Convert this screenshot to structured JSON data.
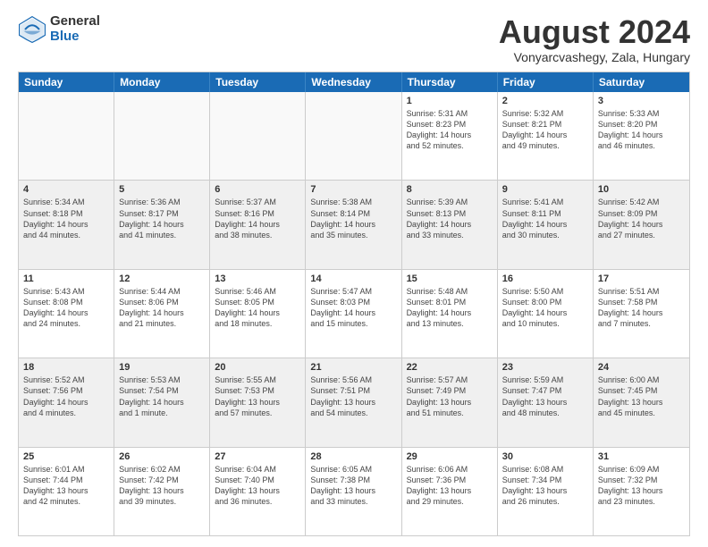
{
  "logo": {
    "general": "General",
    "blue": "Blue"
  },
  "title": "August 2024",
  "subtitle": "Vonyarcvashegy, Zala, Hungary",
  "days": [
    "Sunday",
    "Monday",
    "Tuesday",
    "Wednesday",
    "Thursday",
    "Friday",
    "Saturday"
  ],
  "weeks": [
    [
      {
        "day": "",
        "text": "",
        "empty": true
      },
      {
        "day": "",
        "text": "",
        "empty": true
      },
      {
        "day": "",
        "text": "",
        "empty": true
      },
      {
        "day": "",
        "text": "",
        "empty": true
      },
      {
        "day": "1",
        "text": "Sunrise: 5:31 AM\nSunset: 8:23 PM\nDaylight: 14 hours\nand 52 minutes.",
        "empty": false
      },
      {
        "day": "2",
        "text": "Sunrise: 5:32 AM\nSunset: 8:21 PM\nDaylight: 14 hours\nand 49 minutes.",
        "empty": false
      },
      {
        "day": "3",
        "text": "Sunrise: 5:33 AM\nSunset: 8:20 PM\nDaylight: 14 hours\nand 46 minutes.",
        "empty": false
      }
    ],
    [
      {
        "day": "4",
        "text": "Sunrise: 5:34 AM\nSunset: 8:18 PM\nDaylight: 14 hours\nand 44 minutes.",
        "empty": false,
        "shaded": true
      },
      {
        "day": "5",
        "text": "Sunrise: 5:36 AM\nSunset: 8:17 PM\nDaylight: 14 hours\nand 41 minutes.",
        "empty": false,
        "shaded": true
      },
      {
        "day": "6",
        "text": "Sunrise: 5:37 AM\nSunset: 8:16 PM\nDaylight: 14 hours\nand 38 minutes.",
        "empty": false,
        "shaded": true
      },
      {
        "day": "7",
        "text": "Sunrise: 5:38 AM\nSunset: 8:14 PM\nDaylight: 14 hours\nand 35 minutes.",
        "empty": false,
        "shaded": true
      },
      {
        "day": "8",
        "text": "Sunrise: 5:39 AM\nSunset: 8:13 PM\nDaylight: 14 hours\nand 33 minutes.",
        "empty": false,
        "shaded": true
      },
      {
        "day": "9",
        "text": "Sunrise: 5:41 AM\nSunset: 8:11 PM\nDaylight: 14 hours\nand 30 minutes.",
        "empty": false,
        "shaded": true
      },
      {
        "day": "10",
        "text": "Sunrise: 5:42 AM\nSunset: 8:09 PM\nDaylight: 14 hours\nand 27 minutes.",
        "empty": false,
        "shaded": true
      }
    ],
    [
      {
        "day": "11",
        "text": "Sunrise: 5:43 AM\nSunset: 8:08 PM\nDaylight: 14 hours\nand 24 minutes.",
        "empty": false
      },
      {
        "day": "12",
        "text": "Sunrise: 5:44 AM\nSunset: 8:06 PM\nDaylight: 14 hours\nand 21 minutes.",
        "empty": false
      },
      {
        "day": "13",
        "text": "Sunrise: 5:46 AM\nSunset: 8:05 PM\nDaylight: 14 hours\nand 18 minutes.",
        "empty": false
      },
      {
        "day": "14",
        "text": "Sunrise: 5:47 AM\nSunset: 8:03 PM\nDaylight: 14 hours\nand 15 minutes.",
        "empty": false
      },
      {
        "day": "15",
        "text": "Sunrise: 5:48 AM\nSunset: 8:01 PM\nDaylight: 14 hours\nand 13 minutes.",
        "empty": false
      },
      {
        "day": "16",
        "text": "Sunrise: 5:50 AM\nSunset: 8:00 PM\nDaylight: 14 hours\nand 10 minutes.",
        "empty": false
      },
      {
        "day": "17",
        "text": "Sunrise: 5:51 AM\nSunset: 7:58 PM\nDaylight: 14 hours\nand 7 minutes.",
        "empty": false
      }
    ],
    [
      {
        "day": "18",
        "text": "Sunrise: 5:52 AM\nSunset: 7:56 PM\nDaylight: 14 hours\nand 4 minutes.",
        "empty": false,
        "shaded": true
      },
      {
        "day": "19",
        "text": "Sunrise: 5:53 AM\nSunset: 7:54 PM\nDaylight: 14 hours\nand 1 minute.",
        "empty": false,
        "shaded": true
      },
      {
        "day": "20",
        "text": "Sunrise: 5:55 AM\nSunset: 7:53 PM\nDaylight: 13 hours\nand 57 minutes.",
        "empty": false,
        "shaded": true
      },
      {
        "day": "21",
        "text": "Sunrise: 5:56 AM\nSunset: 7:51 PM\nDaylight: 13 hours\nand 54 minutes.",
        "empty": false,
        "shaded": true
      },
      {
        "day": "22",
        "text": "Sunrise: 5:57 AM\nSunset: 7:49 PM\nDaylight: 13 hours\nand 51 minutes.",
        "empty": false,
        "shaded": true
      },
      {
        "day": "23",
        "text": "Sunrise: 5:59 AM\nSunset: 7:47 PM\nDaylight: 13 hours\nand 48 minutes.",
        "empty": false,
        "shaded": true
      },
      {
        "day": "24",
        "text": "Sunrise: 6:00 AM\nSunset: 7:45 PM\nDaylight: 13 hours\nand 45 minutes.",
        "empty": false,
        "shaded": true
      }
    ],
    [
      {
        "day": "25",
        "text": "Sunrise: 6:01 AM\nSunset: 7:44 PM\nDaylight: 13 hours\nand 42 minutes.",
        "empty": false
      },
      {
        "day": "26",
        "text": "Sunrise: 6:02 AM\nSunset: 7:42 PM\nDaylight: 13 hours\nand 39 minutes.",
        "empty": false
      },
      {
        "day": "27",
        "text": "Sunrise: 6:04 AM\nSunset: 7:40 PM\nDaylight: 13 hours\nand 36 minutes.",
        "empty": false
      },
      {
        "day": "28",
        "text": "Sunrise: 6:05 AM\nSunset: 7:38 PM\nDaylight: 13 hours\nand 33 minutes.",
        "empty": false
      },
      {
        "day": "29",
        "text": "Sunrise: 6:06 AM\nSunset: 7:36 PM\nDaylight: 13 hours\nand 29 minutes.",
        "empty": false
      },
      {
        "day": "30",
        "text": "Sunrise: 6:08 AM\nSunset: 7:34 PM\nDaylight: 13 hours\nand 26 minutes.",
        "empty": false
      },
      {
        "day": "31",
        "text": "Sunrise: 6:09 AM\nSunset: 7:32 PM\nDaylight: 13 hours\nand 23 minutes.",
        "empty": false
      }
    ]
  ]
}
